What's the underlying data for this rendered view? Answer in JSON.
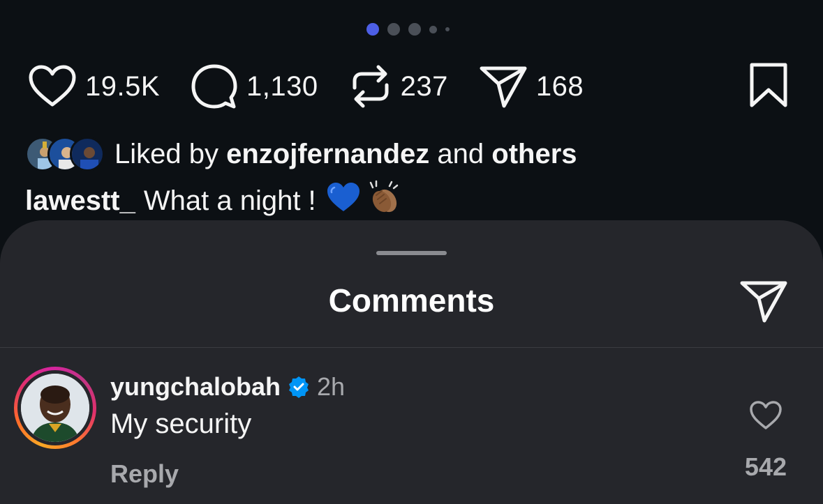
{
  "carousel": {
    "total": 5,
    "active": 0
  },
  "actions": {
    "likes": "19.5K",
    "comments": "1,130",
    "reposts": "237",
    "shares": "168"
  },
  "liked_by": {
    "prefix": "Liked by",
    "user": "enzojfernandez",
    "middle": "and",
    "suffix": "others"
  },
  "caption": {
    "user": "lawestt_",
    "text": "What a night !"
  },
  "sheet": {
    "title": "Comments"
  },
  "comment": {
    "user": "yungchalobah",
    "time": "2h",
    "text": "My security",
    "reply_label": "Reply",
    "like_count": "542"
  },
  "colors": {
    "background": "#0c1014",
    "sheet": "#25262b",
    "active_dot": "#4d5fe6",
    "verified": "#0095f6"
  }
}
